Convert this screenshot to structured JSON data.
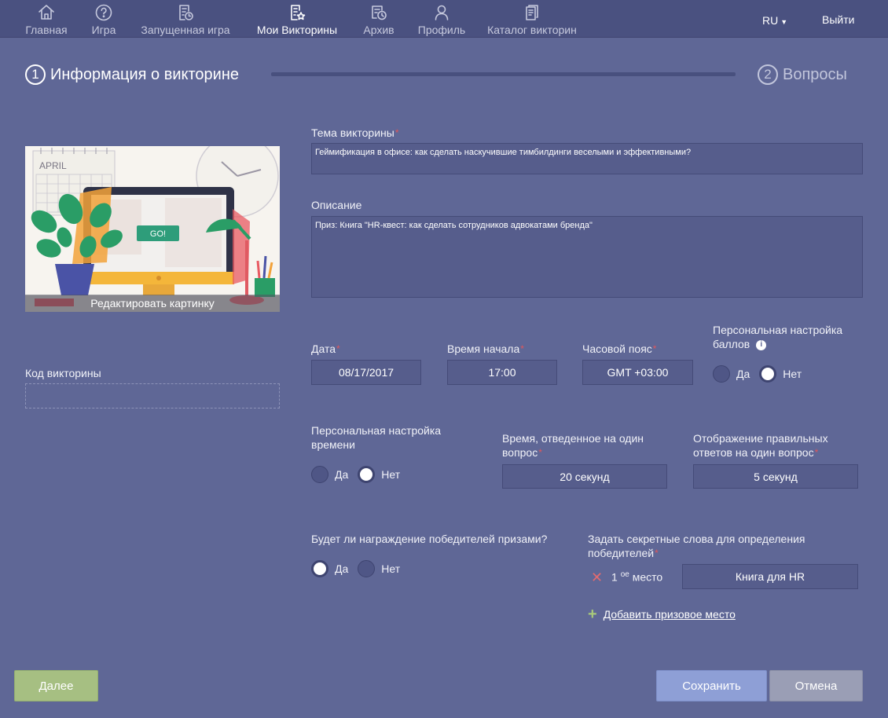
{
  "nav": {
    "items": [
      {
        "label": "Главная",
        "icon": "home-icon"
      },
      {
        "label": "Игра",
        "icon": "question-icon"
      },
      {
        "label": "Запущенная игра",
        "icon": "running-game-icon"
      },
      {
        "label": "Мои Викторины",
        "icon": "my-quizzes-icon"
      },
      {
        "label": "Архив",
        "icon": "archive-icon"
      },
      {
        "label": "Профиль",
        "icon": "profile-icon"
      },
      {
        "label": "Каталог викторин",
        "icon": "catalog-icon"
      }
    ],
    "active": "Мои Викторины",
    "lang": "RU",
    "logout": "Выйти"
  },
  "steps": {
    "step1": {
      "num": "1",
      "label": "Информация о викторине"
    },
    "step2": {
      "num": "2",
      "label": "Вопросы"
    }
  },
  "cover": {
    "caption": "Редактировать картинку",
    "calendar_month": "APRIL",
    "screen_button": "GO!"
  },
  "code": {
    "label": "Код викторины",
    "value": ""
  },
  "theme": {
    "label": "Тема викторины",
    "value": "Геймификация в офисе: как сделать наскучившие тимбилдинги веселыми и эффективными?"
  },
  "description": {
    "label": "Описание",
    "value": "Приз: Книга \"HR-квест: как сделать сотрудников адвокатами бренда\""
  },
  "date": {
    "label": "Дата",
    "value": "08/17/2017"
  },
  "start_time": {
    "label": "Время начала",
    "value": "17:00"
  },
  "timezone": {
    "label": "Часовой пояс",
    "value": "GMT +03:00"
  },
  "score_settings": {
    "label": "Персональная настройка баллов",
    "yes": "Да",
    "no": "Нет",
    "selected": "no"
  },
  "time_settings": {
    "label": "Персональная настройка времени",
    "yes": "Да",
    "no": "Нет",
    "selected": "no"
  },
  "time_per_question": {
    "label": "Время, отведенное на один вопрос",
    "value": "20 секунд"
  },
  "answers_display": {
    "label": "Отображение правильных ответов на один вопрос",
    "value": "5 секунд"
  },
  "prizes": {
    "label": "Будет ли награждение победителей призами?",
    "yes": "Да",
    "no": "Нет",
    "selected": "yes"
  },
  "secret_words": {
    "label": "Задать секретные слова для определения победителей",
    "places": [
      {
        "num": "1",
        "suffix": "ое",
        "word": "место",
        "value": "Книга для HR"
      }
    ],
    "add_label": "Добавить призовое место"
  },
  "buttons": {
    "next": "Далее",
    "save": "Сохранить",
    "cancel": "Отмена"
  },
  "colors": {
    "background": "#5f6796",
    "nav": "#4a5180",
    "next": "#a6bf82",
    "save": "#8e9fd6",
    "cancel": "#9a9eb5",
    "required": "#e0575b"
  }
}
